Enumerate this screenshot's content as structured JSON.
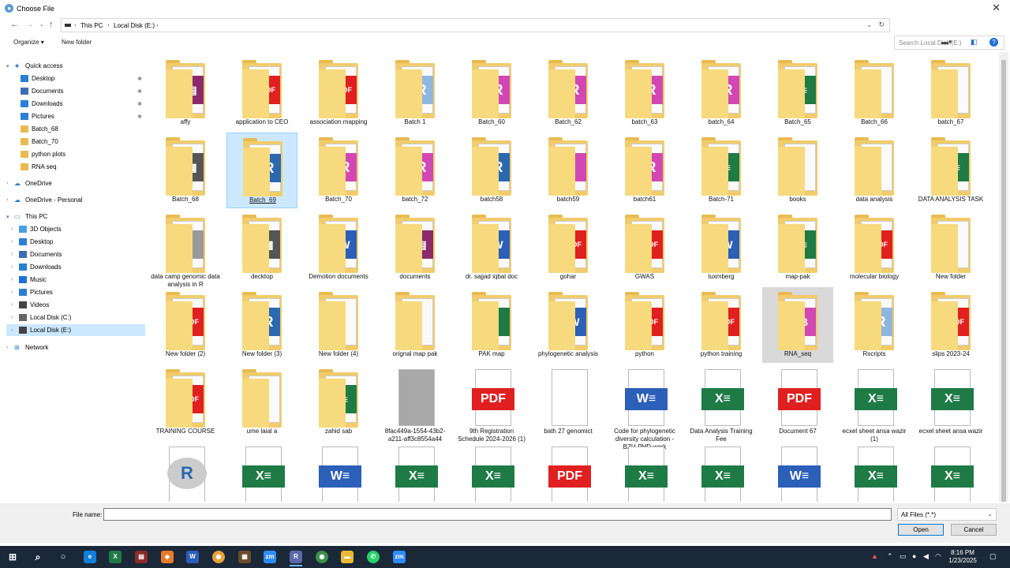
{
  "window": {
    "title": "Choose File"
  },
  "address": {
    "crumbs": [
      "This PC",
      "Local Disk (E:)"
    ],
    "search_placeholder": "Search Local Disk (E:)"
  },
  "toolbar": {
    "organize": "Organize",
    "new_folder": "New folder"
  },
  "nav": {
    "quick_access": "Quick access",
    "qa_items": [
      "Desktop",
      "Documents",
      "Downloads",
      "Pictures",
      "Batch_68",
      "Batch_70",
      "python plots",
      "RNA seq"
    ],
    "onedrive": "OneDrive",
    "onedrive_personal": "OneDrive - Personal",
    "this_pc": "This PC",
    "pc_items": [
      "3D Objects",
      "Desktop",
      "Documents",
      "Downloads",
      "Music",
      "Pictures",
      "Videos",
      "Local Disk (C:)",
      "Local Disk (E:)"
    ],
    "network": "Network"
  },
  "items": [
    {
      "label": "affy",
      "kind": "folder",
      "thumb": "winrar"
    },
    {
      "label": "application to CEO",
      "kind": "folder",
      "thumb": "pdf"
    },
    {
      "label": "association mapping",
      "kind": "folder",
      "thumb": "pdf"
    },
    {
      "label": "Batch 1",
      "kind": "folder",
      "thumb": "r-light"
    },
    {
      "label": "Batch_60",
      "kind": "folder",
      "thumb": "r-pink"
    },
    {
      "label": "Batch_62",
      "kind": "folder",
      "thumb": "r-pink"
    },
    {
      "label": "batch_63",
      "kind": "folder",
      "thumb": "r-pink"
    },
    {
      "label": "batch_64",
      "kind": "folder",
      "thumb": "r-pink"
    },
    {
      "label": "Batch_65",
      "kind": "folder",
      "thumb": "excel"
    },
    {
      "label": "Batch_66",
      "kind": "folder",
      "thumb": "blank"
    },
    {
      "label": "batch_67",
      "kind": "folder",
      "thumb": "blank"
    },
    {
      "label": "Batch_68",
      "kind": "folder",
      "thumb": "photo"
    },
    {
      "label": "Batch_69",
      "kind": "folder",
      "thumb": "r",
      "selected": true
    },
    {
      "label": "Batch_70",
      "kind": "folder",
      "thumb": "r-pink"
    },
    {
      "label": "batch_72",
      "kind": "folder",
      "thumb": "r-pink"
    },
    {
      "label": "batch58",
      "kind": "folder",
      "thumb": "r"
    },
    {
      "label": "batch59",
      "kind": "folder",
      "thumb": "pink"
    },
    {
      "label": "batch61",
      "kind": "folder",
      "thumb": "r-pink"
    },
    {
      "label": "Batch-71",
      "kind": "folder",
      "thumb": "excel"
    },
    {
      "label": "books",
      "kind": "folder",
      "thumb": "empty"
    },
    {
      "label": "data analysis",
      "kind": "folder",
      "thumb": "blank"
    },
    {
      "label": "DATA ANALYSIS TASK",
      "kind": "folder",
      "thumb": "excel"
    },
    {
      "label": "data camp genomic data analysis in R",
      "kind": "folder",
      "thumb": "doc"
    },
    {
      "label": "decktop",
      "kind": "folder",
      "thumb": "photo"
    },
    {
      "label": "Demotion documents",
      "kind": "folder",
      "thumb": "word-pdf"
    },
    {
      "label": "documents",
      "kind": "folder",
      "thumb": "winrar"
    },
    {
      "label": "dr. sajjad iqbal doc",
      "kind": "folder",
      "thumb": "word"
    },
    {
      "label": "gohar",
      "kind": "folder",
      "thumb": "pdf"
    },
    {
      "label": "GWAS",
      "kind": "folder",
      "thumb": "pdf"
    },
    {
      "label": "luxmberg",
      "kind": "folder",
      "thumb": "word-pdf"
    },
    {
      "label": "map-pak",
      "kind": "folder",
      "thumb": "excel"
    },
    {
      "label": "molecular biology",
      "kind": "folder",
      "thumb": "pdf"
    },
    {
      "label": "New folder",
      "kind": "folder",
      "thumb": "blank"
    },
    {
      "label": "New folder (2)",
      "kind": "folder",
      "thumb": "pdf"
    },
    {
      "label": "New folder (3)",
      "kind": "folder",
      "thumb": "r"
    },
    {
      "label": "New folder (4)",
      "kind": "folder",
      "thumb": "empty"
    },
    {
      "label": "orignal map pak",
      "kind": "folder",
      "thumb": "blank"
    },
    {
      "label": "PAK map",
      "kind": "folder",
      "thumb": "green"
    },
    {
      "label": "phylogenetic analysis",
      "kind": "folder",
      "thumb": "word"
    },
    {
      "label": "python",
      "kind": "folder",
      "thumb": "pdf"
    },
    {
      "label": "python training",
      "kind": "folder",
      "thumb": "pdf"
    },
    {
      "label": "RNA_seq",
      "kind": "folder",
      "thumb": "excel-pink",
      "hover": true
    },
    {
      "label": "Rscripts",
      "kind": "folder",
      "thumb": "r-light"
    },
    {
      "label": "slips 2023-24",
      "kind": "folder",
      "thumb": "pdf"
    },
    {
      "label": "TRAINING COURSE",
      "kind": "folder",
      "thumb": "pdf"
    },
    {
      "label": "ume laial a",
      "kind": "folder",
      "thumb": "blank"
    },
    {
      "label": "zahid sab",
      "kind": "folder",
      "thumb": "excel"
    },
    {
      "label": "8fac449a-1554-43b2-a211-aff3c8554a44",
      "kind": "file",
      "thumb": "gray"
    },
    {
      "label": "9th Registration Schedule 2024-2026 (1)",
      "kind": "file",
      "thumb": "pdf-file"
    },
    {
      "label": "bath 27 genomict",
      "kind": "file",
      "thumb": "blank-file"
    },
    {
      "label": "Code for phylogenetic diversity calculation -BZU-PHD work",
      "kind": "file",
      "thumb": "word-file"
    },
    {
      "label": "Data Analysis Training Fee",
      "kind": "file",
      "thumb": "excel-file"
    },
    {
      "label": "Document 67",
      "kind": "file",
      "thumb": "pdf-file"
    },
    {
      "label": "ecxel sheet ansa wazir (1)",
      "kind": "file",
      "thumb": "excel-file"
    },
    {
      "label": "ecxel sheet ansa wazir",
      "kind": "file",
      "thumb": "excel-file"
    },
    {
      "label": "",
      "kind": "file",
      "thumb": "r-file"
    },
    {
      "label": "",
      "kind": "file",
      "thumb": "excel-file"
    },
    {
      "label": "",
      "kind": "file",
      "thumb": "word-file"
    },
    {
      "label": "",
      "kind": "file",
      "thumb": "excel-file"
    },
    {
      "label": "",
      "kind": "file",
      "thumb": "excel-file"
    },
    {
      "label": "",
      "kind": "file",
      "thumb": "pdf-file"
    },
    {
      "label": "",
      "kind": "file",
      "thumb": "excel-file"
    },
    {
      "label": "",
      "kind": "file",
      "thumb": "excel-file"
    },
    {
      "label": "",
      "kind": "file",
      "thumb": "word-file"
    },
    {
      "label": "",
      "kind": "file",
      "thumb": "excel-file"
    },
    {
      "label": "",
      "kind": "file",
      "thumb": "excel-file"
    }
  ],
  "footer": {
    "file_name_label": "File name:",
    "file_name_value": "",
    "filter": "All Files (*.*)",
    "open": "Open",
    "cancel": "Cancel"
  },
  "taskbar": {
    "time": "8:16 PM",
    "date": "1/23/2025"
  },
  "colors": {
    "pdf": "#e02020",
    "word": "#2b5fb8",
    "excel": "#1e7b45",
    "r": "#2a68b0",
    "pink": "#d148b5",
    "selection": "#cce8ff",
    "folder": "#f2cc6b"
  }
}
